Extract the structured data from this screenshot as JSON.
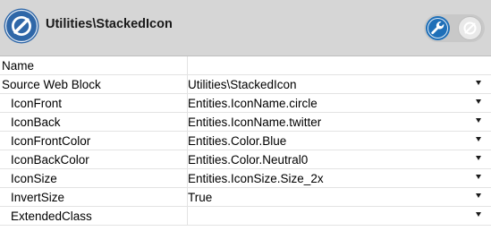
{
  "header": {
    "title": "Utilities\\StackedIcon",
    "icon": "web-block-icon",
    "toggles": [
      {
        "icon": "wrench-icon",
        "state": "active",
        "color": "#1e6fb8"
      },
      {
        "icon": "disabled-slash-icon",
        "state": "inactive"
      }
    ]
  },
  "properties": [
    {
      "name": "Name",
      "value": "",
      "dropdown": false
    },
    {
      "name": "Source Web Block",
      "value": "Utilities\\StackedIcon",
      "dropdown": true
    },
    {
      "name": "IconFront",
      "value": "Entities.IconName.circle",
      "dropdown": true
    },
    {
      "name": "IconBack",
      "value": "Entities.IconName.twitter",
      "dropdown": true
    },
    {
      "name": "IconFrontColor",
      "value": "Entities.Color.Blue",
      "dropdown": true
    },
    {
      "name": "IconBackColor",
      "value": "Entities.Color.Neutral0",
      "dropdown": true
    },
    {
      "name": "IconSize",
      "value": "Entities.IconSize.Size_2x",
      "dropdown": true
    },
    {
      "name": "InvertSize",
      "value": "True",
      "dropdown": true
    },
    {
      "name": "ExtendedClass",
      "value": "",
      "dropdown": true
    }
  ],
  "colors": {
    "header_bg": "#d6d6d6",
    "accent": "#1e6fb8",
    "grid": "#e3e3e3"
  }
}
